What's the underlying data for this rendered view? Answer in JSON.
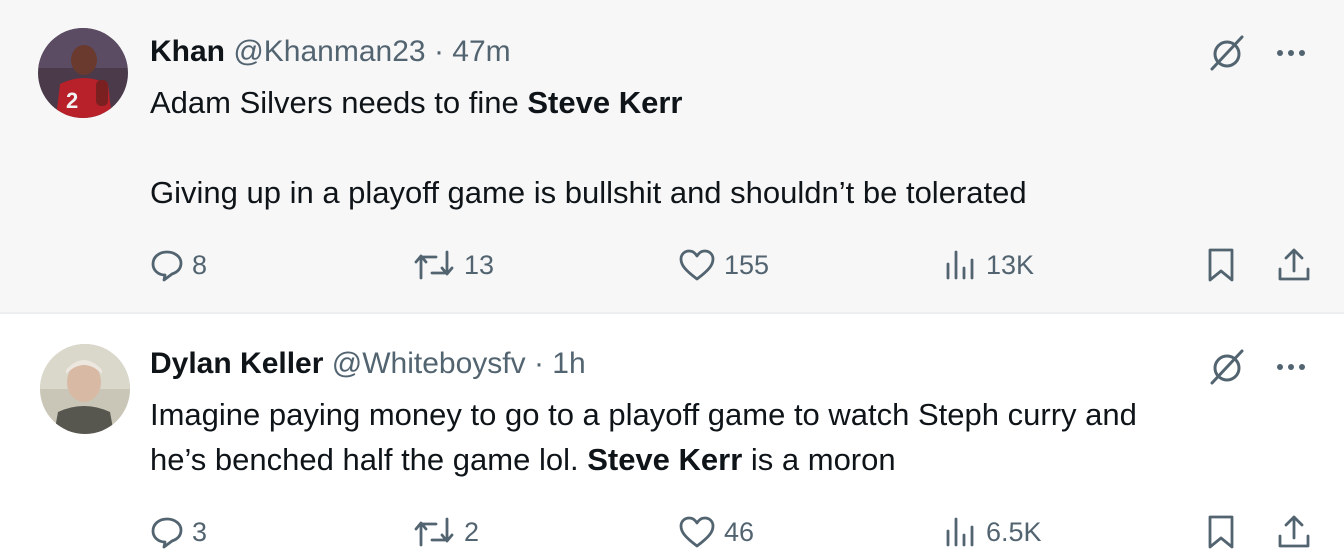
{
  "tweets": [
    {
      "name": "Khan",
      "handle": "@Khanman23",
      "separator": "·",
      "time": "47m",
      "text_line1_pre": "Adam Silvers needs to fine ",
      "text_line1_bold": "Steve Kerr",
      "text_line3": "Giving up in a playoff game is bullshit and shouldn’t be tolerated",
      "replies": "8",
      "retweets": "13",
      "likes": "155",
      "views": "13K",
      "avatar_jersey_number": "2"
    },
    {
      "name": "Dylan Keller",
      "handle": "@Whiteboysfv",
      "separator": "·",
      "time": "1h",
      "text_line1": "Imagine paying money to go to a playoff game to watch Steph curry and",
      "text_line2_pre": "he’s benched half the game lol. ",
      "text_line2_bold": "Steve Kerr",
      "text_line2_post": " is a moron",
      "replies": "3",
      "retweets": "2",
      "likes": "46",
      "views": "6.5K"
    }
  ],
  "icons": {
    "grok": "grok-icon",
    "more": "more-icon",
    "reply": "reply-icon",
    "retweet": "retweet-icon",
    "like": "like-icon",
    "views": "views-icon",
    "bookmark": "bookmark-icon",
    "share": "share-icon"
  },
  "colors": {
    "text": "#0f1419",
    "secondary": "#536471",
    "background_first": "#f7f7f7",
    "background_second": "#ffffff"
  }
}
